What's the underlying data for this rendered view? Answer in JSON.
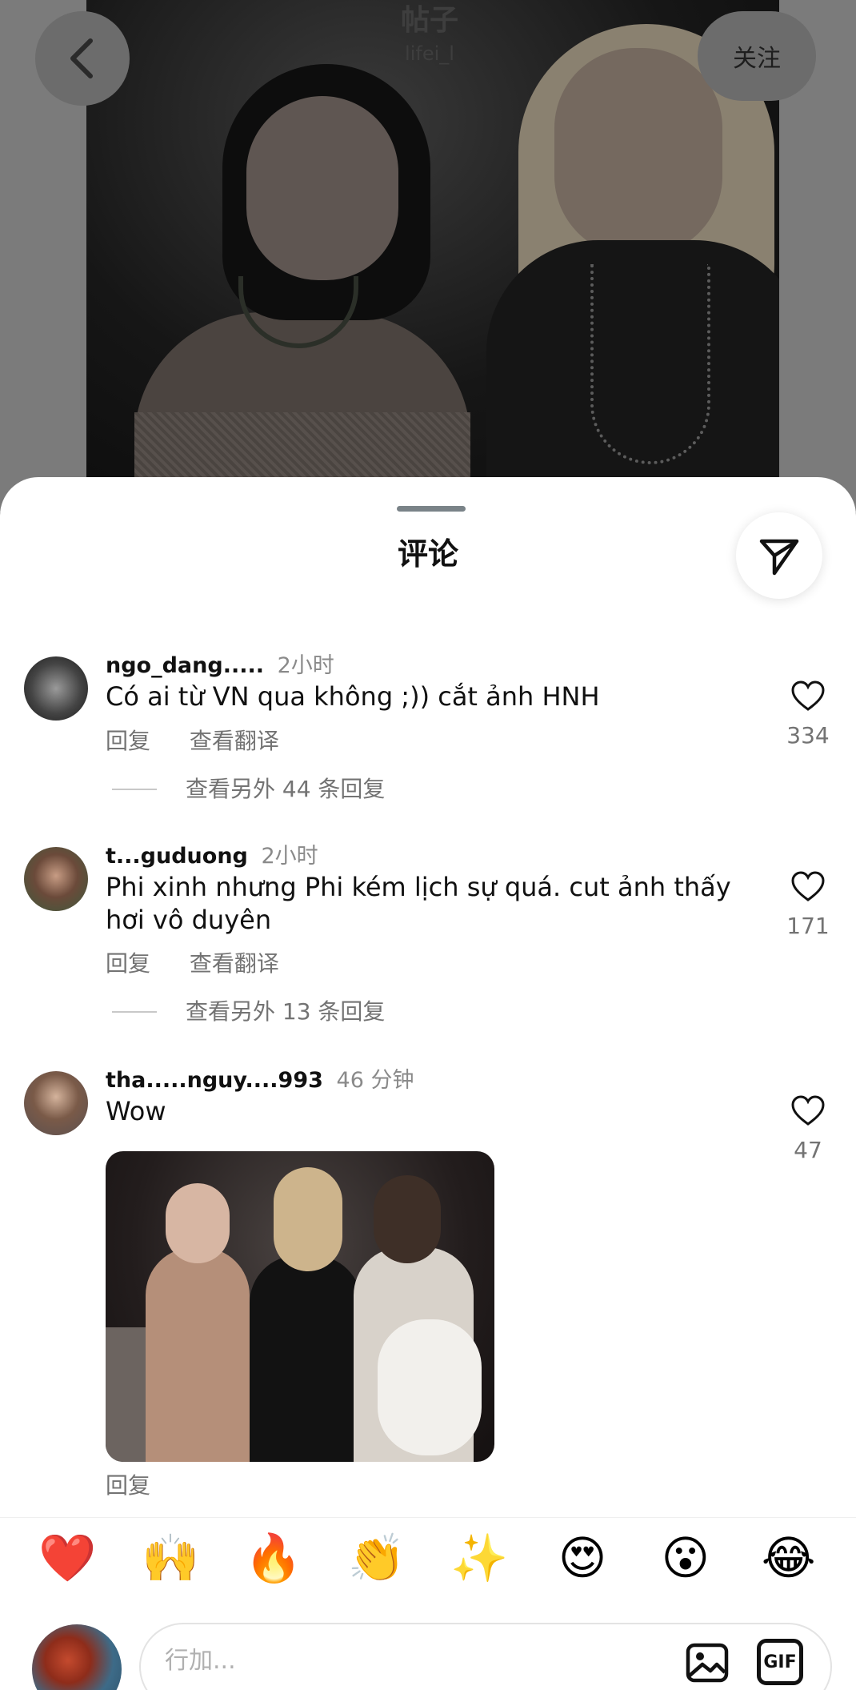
{
  "post": {
    "title": "帖子",
    "subtitle": "lifei_l",
    "follow_label": "关注"
  },
  "sheet": {
    "title": "评论"
  },
  "comments": [
    {
      "user": "ngo_dang.....",
      "time": "2小时",
      "text": "Có ai từ VN qua không ;)) cắt ảnh HNH",
      "reply_label": "回复",
      "translate_label": "查看翻译",
      "more_replies": "查看另外 44 条回复",
      "likes": "334"
    },
    {
      "user": "t...guduong",
      "time": "2小时",
      "text": "Phi xinh nhưng Phi kém lịch sự quá. cut ảnh thấy hơi vô duyên",
      "reply_label": "回复",
      "translate_label": "查看翻译",
      "more_replies": "查看另外 13 条回复",
      "likes": "171"
    },
    {
      "user": "tha.....nguy....993",
      "time": "46 分钟",
      "text": "Wow",
      "reply_label": "回复",
      "likes": "47"
    }
  ],
  "emoji_bar": [
    "❤️",
    "🙌",
    "🔥",
    "👏",
    "✨",
    "😍",
    "😮",
    "😂"
  ],
  "composer": {
    "placeholder": "行加...",
    "gif_label": "GIF"
  },
  "icons": {
    "back": "chevron-left-icon",
    "share": "send-icon",
    "like": "heart-outline-icon",
    "image": "image-icon",
    "gif": "gif-icon"
  }
}
